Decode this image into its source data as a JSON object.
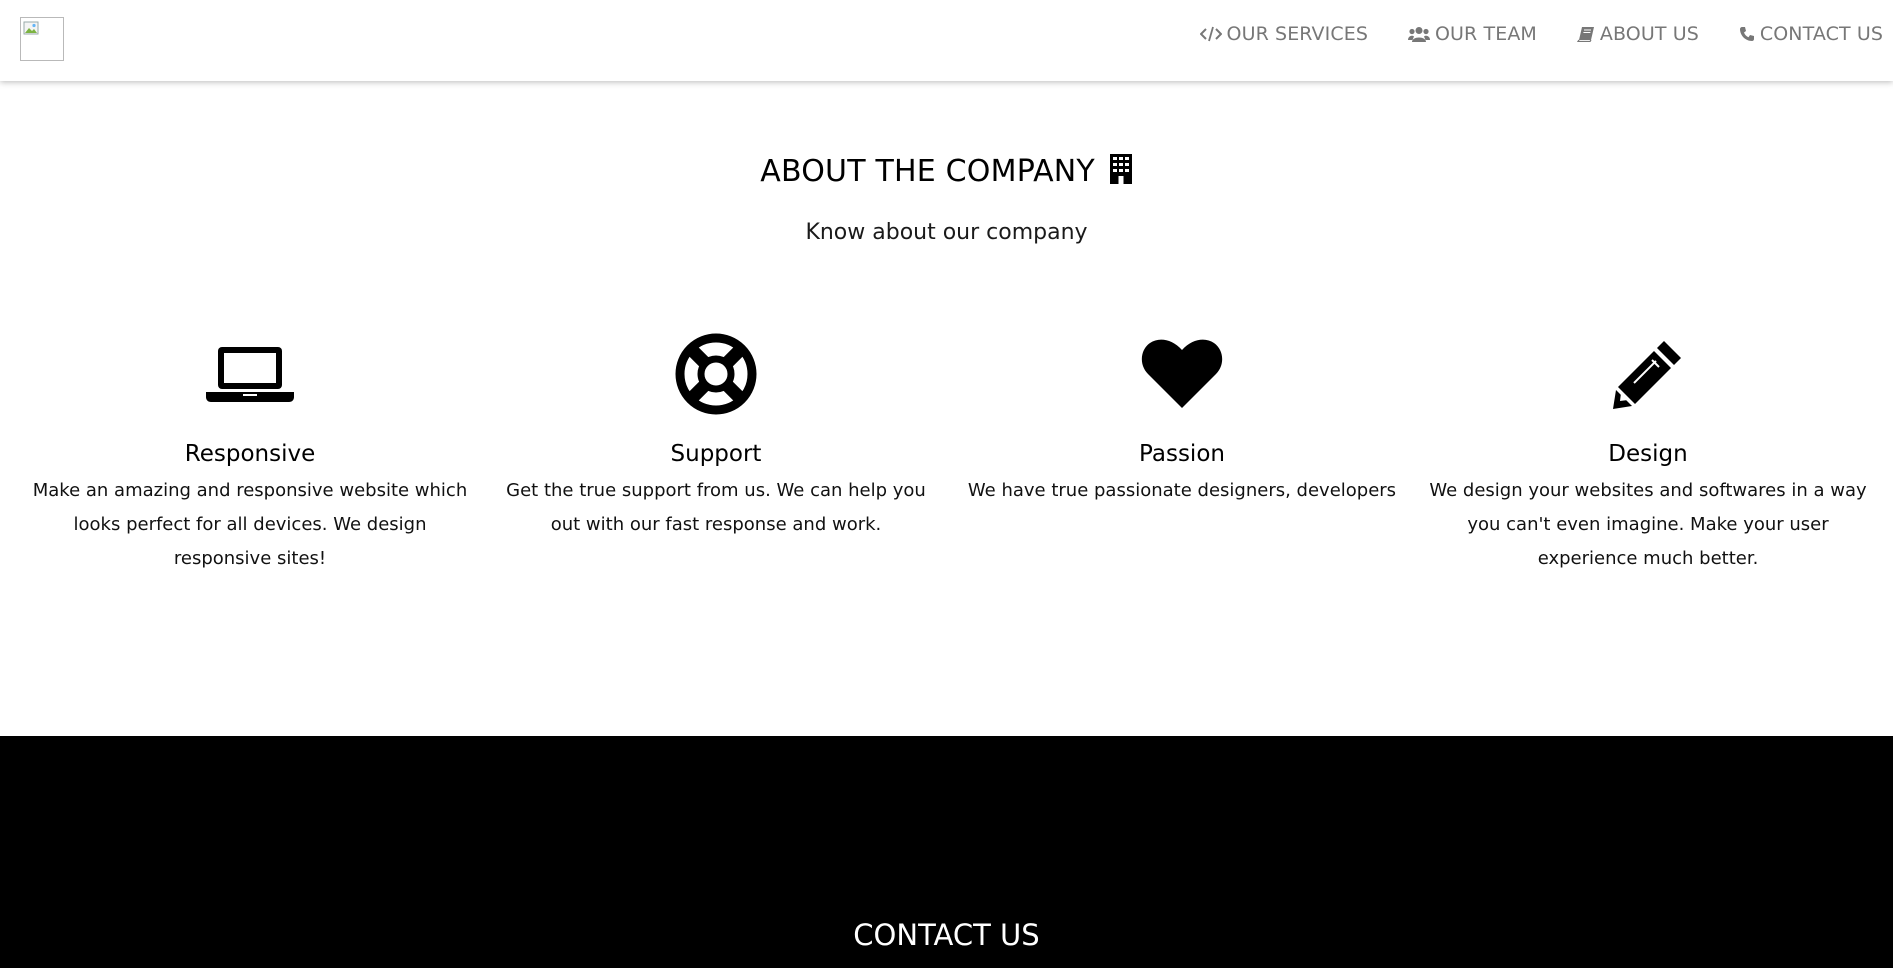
{
  "nav": {
    "items": [
      {
        "label": "OUR SERVICES",
        "icon": "code-icon"
      },
      {
        "label": "OUR TEAM",
        "icon": "users-icon"
      },
      {
        "label": "ABOUT US",
        "icon": "book-icon"
      },
      {
        "label": "CONTACT US",
        "icon": "phone-icon"
      }
    ]
  },
  "about": {
    "title": "ABOUT THE COMPANY",
    "title_icon": "building-icon",
    "subtitle": "Know about our company",
    "features": [
      {
        "icon": "laptop-icon",
        "title": "Responsive",
        "text": "Make an amazing and responsive website which looks perfect for all devices. We design responsive sites!"
      },
      {
        "icon": "life-ring-icon",
        "title": "Support",
        "text": "Get the true support from us. We can help you out with our fast response and work."
      },
      {
        "icon": "heart-icon",
        "title": "Passion",
        "text": "We have true passionate designers, developers and testers to make your work more efficient and"
      },
      {
        "icon": "pencil-icon",
        "title": "Design",
        "text": "We design your websites and softwares in a way you can't even imagine. Make your user experience much better."
      }
    ]
  },
  "contact": {
    "title": "CONTACT US"
  },
  "colors": {
    "nav_text": "#777777",
    "contact_bg": "#000000",
    "contact_text": "#ffffff"
  }
}
